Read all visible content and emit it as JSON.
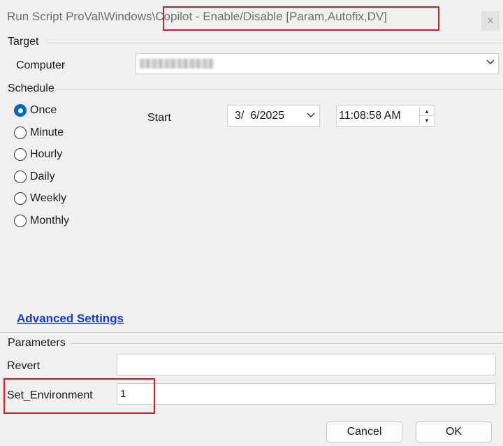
{
  "window": {
    "title_prefix": "Run Script ProVal\\Windows\\",
    "title_script": "Copilot - Enable/Disable [Param,Autofix,DV]",
    "close_glyph": "✕"
  },
  "target": {
    "group_label": "Target",
    "computer_label": "Computer"
  },
  "schedule": {
    "group_label": "Schedule",
    "options": [
      {
        "label": "Once",
        "checked": true
      },
      {
        "label": "Minute",
        "checked": false
      },
      {
        "label": "Hourly",
        "checked": false
      },
      {
        "label": "Daily",
        "checked": false
      },
      {
        "label": "Weekly",
        "checked": false
      },
      {
        "label": "Monthly",
        "checked": false
      }
    ],
    "start_label": "Start",
    "start_date": "3/  6/2025",
    "start_time": "11:08:58 AM",
    "advanced_link": "Advanced Settings"
  },
  "parameters": {
    "group_label": "Parameters",
    "revert_label": "Revert",
    "revert_value": "",
    "set_env_label": "Set_Environment",
    "set_env_value": "1"
  },
  "buttons": {
    "cancel": "Cancel",
    "ok": "OK"
  },
  "colors": {
    "highlight": "#cc1f27",
    "link": "#0b3bd8",
    "radio_checked": "#0067c0"
  }
}
